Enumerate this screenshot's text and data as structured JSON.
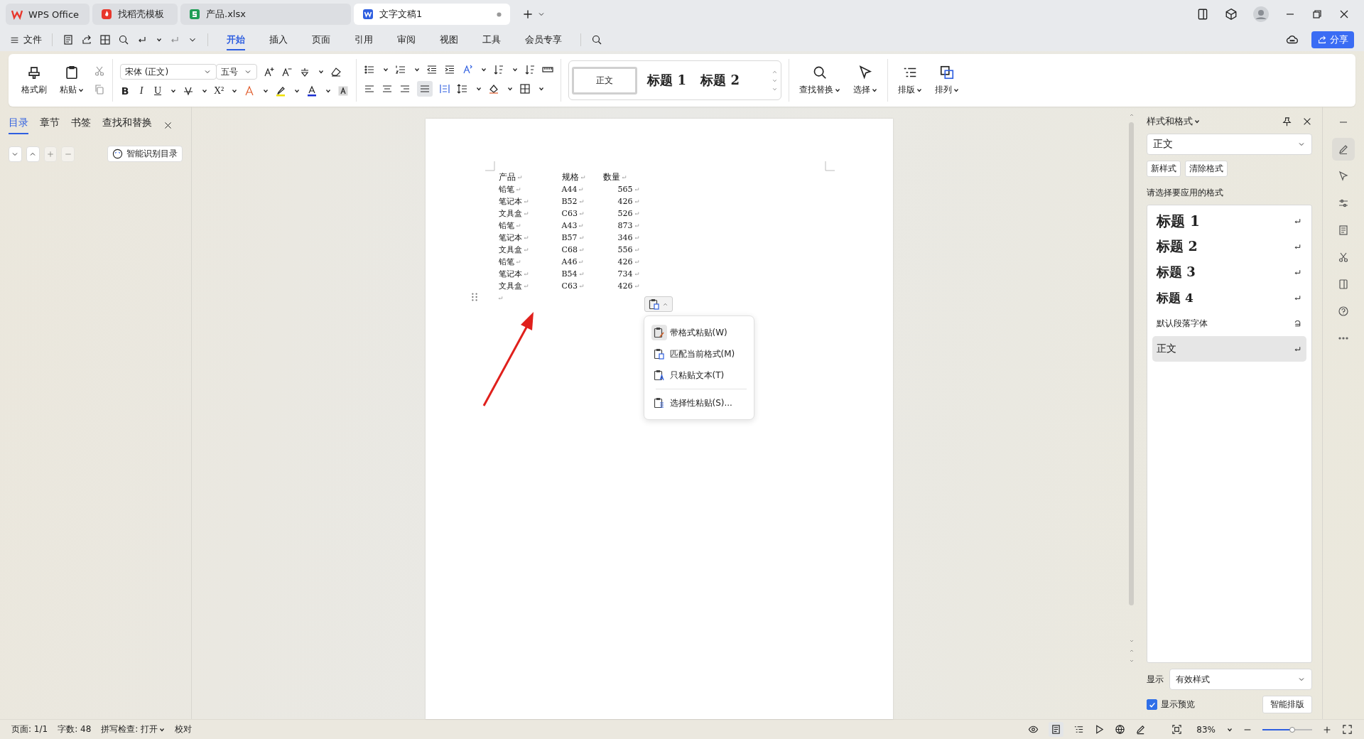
{
  "title_tabs": [
    {
      "label": "WPS Office",
      "kind": "home",
      "selected": false
    },
    {
      "label": "找稻壳模板",
      "kind": "template",
      "selected": false
    },
    {
      "label": "产品.xlsx",
      "kind": "sheet",
      "selected": false
    },
    {
      "label": "文字文稿1",
      "kind": "doc",
      "selected": true
    }
  ],
  "menu": {
    "file": "文件",
    "tabs": [
      {
        "label": "开始",
        "selected": true
      },
      {
        "label": "插入",
        "selected": false
      },
      {
        "label": "页面",
        "selected": false
      },
      {
        "label": "引用",
        "selected": false
      },
      {
        "label": "审阅",
        "selected": false
      },
      {
        "label": "视图",
        "selected": false
      },
      {
        "label": "工具",
        "selected": false
      },
      {
        "label": "会员专享",
        "selected": false
      }
    ],
    "share": "分享"
  },
  "ribbon": {
    "format_painter": "格式刷",
    "paste": "粘贴",
    "font_name": "宋体 (正文)",
    "font_size": "五号",
    "text_format": [
      "B",
      "I",
      "U",
      "X²"
    ],
    "style_gallery": [
      {
        "label": "正文",
        "selected": true
      },
      {
        "label": "标题 1",
        "selected": false
      },
      {
        "label": "标题 2",
        "selected": false
      }
    ],
    "find_replace": "查找替换",
    "select": "选择",
    "layout": "排版",
    "arrange": "排列"
  },
  "nav_panel": {
    "tabs": [
      {
        "label": "目录",
        "selected": true
      },
      {
        "label": "章节",
        "selected": false
      },
      {
        "label": "书签",
        "selected": false
      },
      {
        "label": "查找和替换",
        "selected": false
      }
    ],
    "smart_toc": "智能识别目录"
  },
  "document": {
    "columns": [
      "产品",
      "规格",
      "数量"
    ],
    "rows": [
      [
        "铅笔",
        "A44",
        "565"
      ],
      [
        "笔记本",
        "B52",
        "426"
      ],
      [
        "文具盒",
        "C63",
        "526"
      ],
      [
        "铅笔",
        "A43",
        "873"
      ],
      [
        "笔记本",
        "B57",
        "346"
      ],
      [
        "文具盒",
        "C68",
        "556"
      ],
      [
        "铅笔",
        "A46",
        "426"
      ],
      [
        "笔记本",
        "B54",
        "734"
      ],
      [
        "文具盒",
        "C63",
        "426"
      ]
    ]
  },
  "paste_menu": {
    "items": [
      {
        "label": "带格式粘贴(W)",
        "kind": "keep",
        "selected": true
      },
      {
        "label": "匹配当前格式(M)",
        "kind": "match",
        "selected": false
      },
      {
        "label": "只粘贴文本(T)",
        "kind": "text",
        "selected": false
      },
      {
        "label": "选择性粘贴(S)...",
        "kind": "special",
        "selected": false
      }
    ]
  },
  "styles_panel": {
    "title": "样式和格式",
    "current_style": "正文",
    "new_style": "新样式",
    "clear_format": "清除格式",
    "prompt": "请选择要应用的格式",
    "styles": [
      {
        "label": "标题 1",
        "kind": "heading",
        "selected": false
      },
      {
        "label": "标题 2",
        "kind": "heading",
        "selected": false
      },
      {
        "label": "标题 3",
        "kind": "heading",
        "selected": false
      },
      {
        "label": "标题 4",
        "kind": "heading",
        "selected": false
      },
      {
        "label": "默认段落字体",
        "kind": "character",
        "selected": false
      },
      {
        "label": "正文",
        "kind": "paragraph",
        "selected": true
      }
    ],
    "show_label": "显示",
    "show_value": "有效样式",
    "preview": {
      "label": "显示预览",
      "checked": true
    },
    "smart_layout": "智能排版"
  },
  "status_bar": {
    "page": "页面: 1/1",
    "words": "字数: 48",
    "spell": "拼写检查: 打开",
    "proofread": "校对",
    "zoom": "83%",
    "zoom_slider": {
      "level": 0.6
    }
  }
}
